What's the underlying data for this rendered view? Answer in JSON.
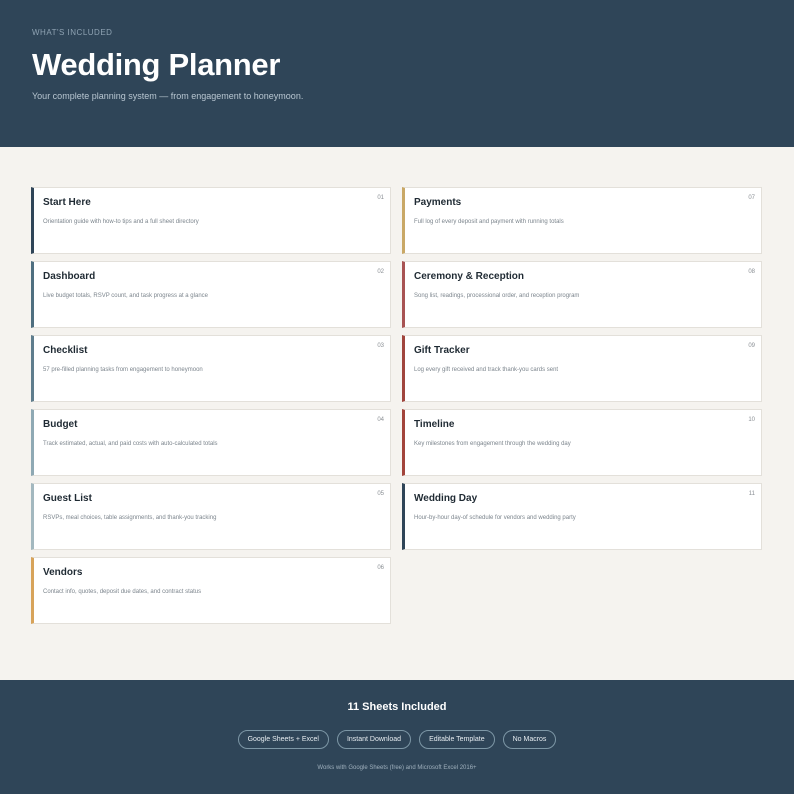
{
  "header": {
    "eyebrow": "WHAT'S INCLUDED",
    "title": "Wedding Planner",
    "subtitle": "Your complete planning system — from engagement to honeymoon."
  },
  "sheets": [
    {
      "num": "01",
      "title": "Start Here",
      "desc": "Orientation guide with how-to tips and a full sheet directory",
      "accent": "#2f4558"
    },
    {
      "num": "02",
      "title": "Dashboard",
      "desc": "Live budget totals, RSVP count, and task progress at a glance",
      "accent": "#4f6f80"
    },
    {
      "num": "03",
      "title": "Checklist",
      "desc": "57 pre-filled planning tasks from engagement to honeymoon",
      "accent": "#5f7d8d"
    },
    {
      "num": "04",
      "title": "Budget",
      "desc": "Track estimated, actual, and paid costs with auto-calculated totals",
      "accent": "#8fa9b4"
    },
    {
      "num": "05",
      "title": "Guest List",
      "desc": "RSVPs, meal choices, table assignments, and thank-you tracking",
      "accent": "#a3b8bf"
    },
    {
      "num": "06",
      "title": "Vendors",
      "desc": "Contact info, quotes, deposit due dates, and contract status",
      "accent": "#d7a35a"
    },
    {
      "num": "07",
      "title": "Payments",
      "desc": "Full log of every deposit and payment with running totals",
      "accent": "#c9a866"
    },
    {
      "num": "08",
      "title": "Ceremony & Reception",
      "desc": "Song list, readings, processional order, and reception program",
      "accent": "#a85353"
    },
    {
      "num": "09",
      "title": "Gift Tracker",
      "desc": "Log every gift received and track thank-you cards sent",
      "accent": "#a0453d"
    },
    {
      "num": "10",
      "title": "Timeline",
      "desc": "Key milestones from engagement through the wedding day",
      "accent": "#a2443b"
    },
    {
      "num": "11",
      "title": "Wedding Day",
      "desc": "Hour-by-hour day-of schedule for vendors and wedding party",
      "accent": "#2f4558"
    }
  ],
  "footer": {
    "title": "11 Sheets Included",
    "badges": [
      "Google Sheets + Excel",
      "Instant Download",
      "Editable Template",
      "No Macros"
    ],
    "note": "Works with Google Sheets (free) and Microsoft Excel 2016+"
  }
}
